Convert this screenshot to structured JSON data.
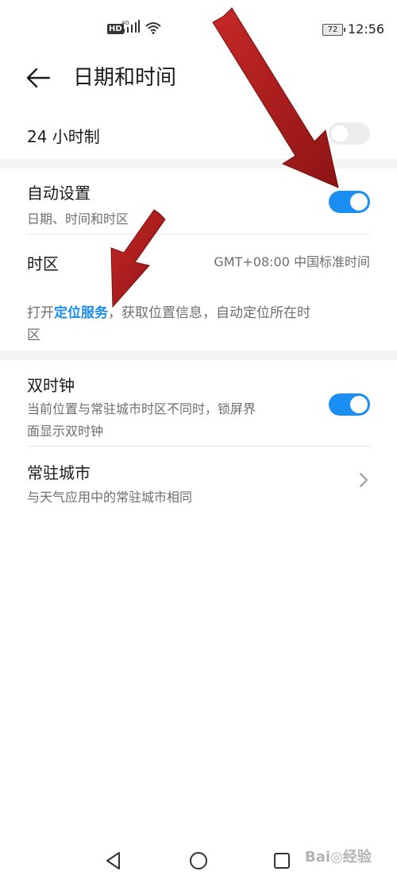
{
  "status_bar": {
    "network_badge": "HD",
    "signal_label": "4G",
    "battery_level": "72",
    "time": "12:56"
  },
  "header": {
    "title": "日期和时间"
  },
  "settings": {
    "hour24": {
      "label": "24 小时制",
      "enabled": false
    },
    "auto_set": {
      "label": "自动设置",
      "subtitle": "日期、时间和时区",
      "enabled": true
    },
    "timezone": {
      "label": "时区",
      "value": "GMT+08:00 中国标准时间"
    },
    "location_hint": {
      "prefix": "打开",
      "link": "定位服务",
      "suffix_line1": "，获取位置信息，自动定位所在时",
      "suffix_line2": "区"
    },
    "dual_clock": {
      "label": "双时钟",
      "subtitle_line1": "当前位置与常驻城市时区不同时，锁屏界",
      "subtitle_line2": "面显示双时钟",
      "enabled": true
    },
    "home_city": {
      "label": "常驻城市",
      "subtitle": "与天气应用中的常驻城市相同"
    }
  },
  "watermark": "Bai◎经验",
  "colors": {
    "accent": "#1a8ef3",
    "annotation_arrow": "#b71c1c"
  }
}
